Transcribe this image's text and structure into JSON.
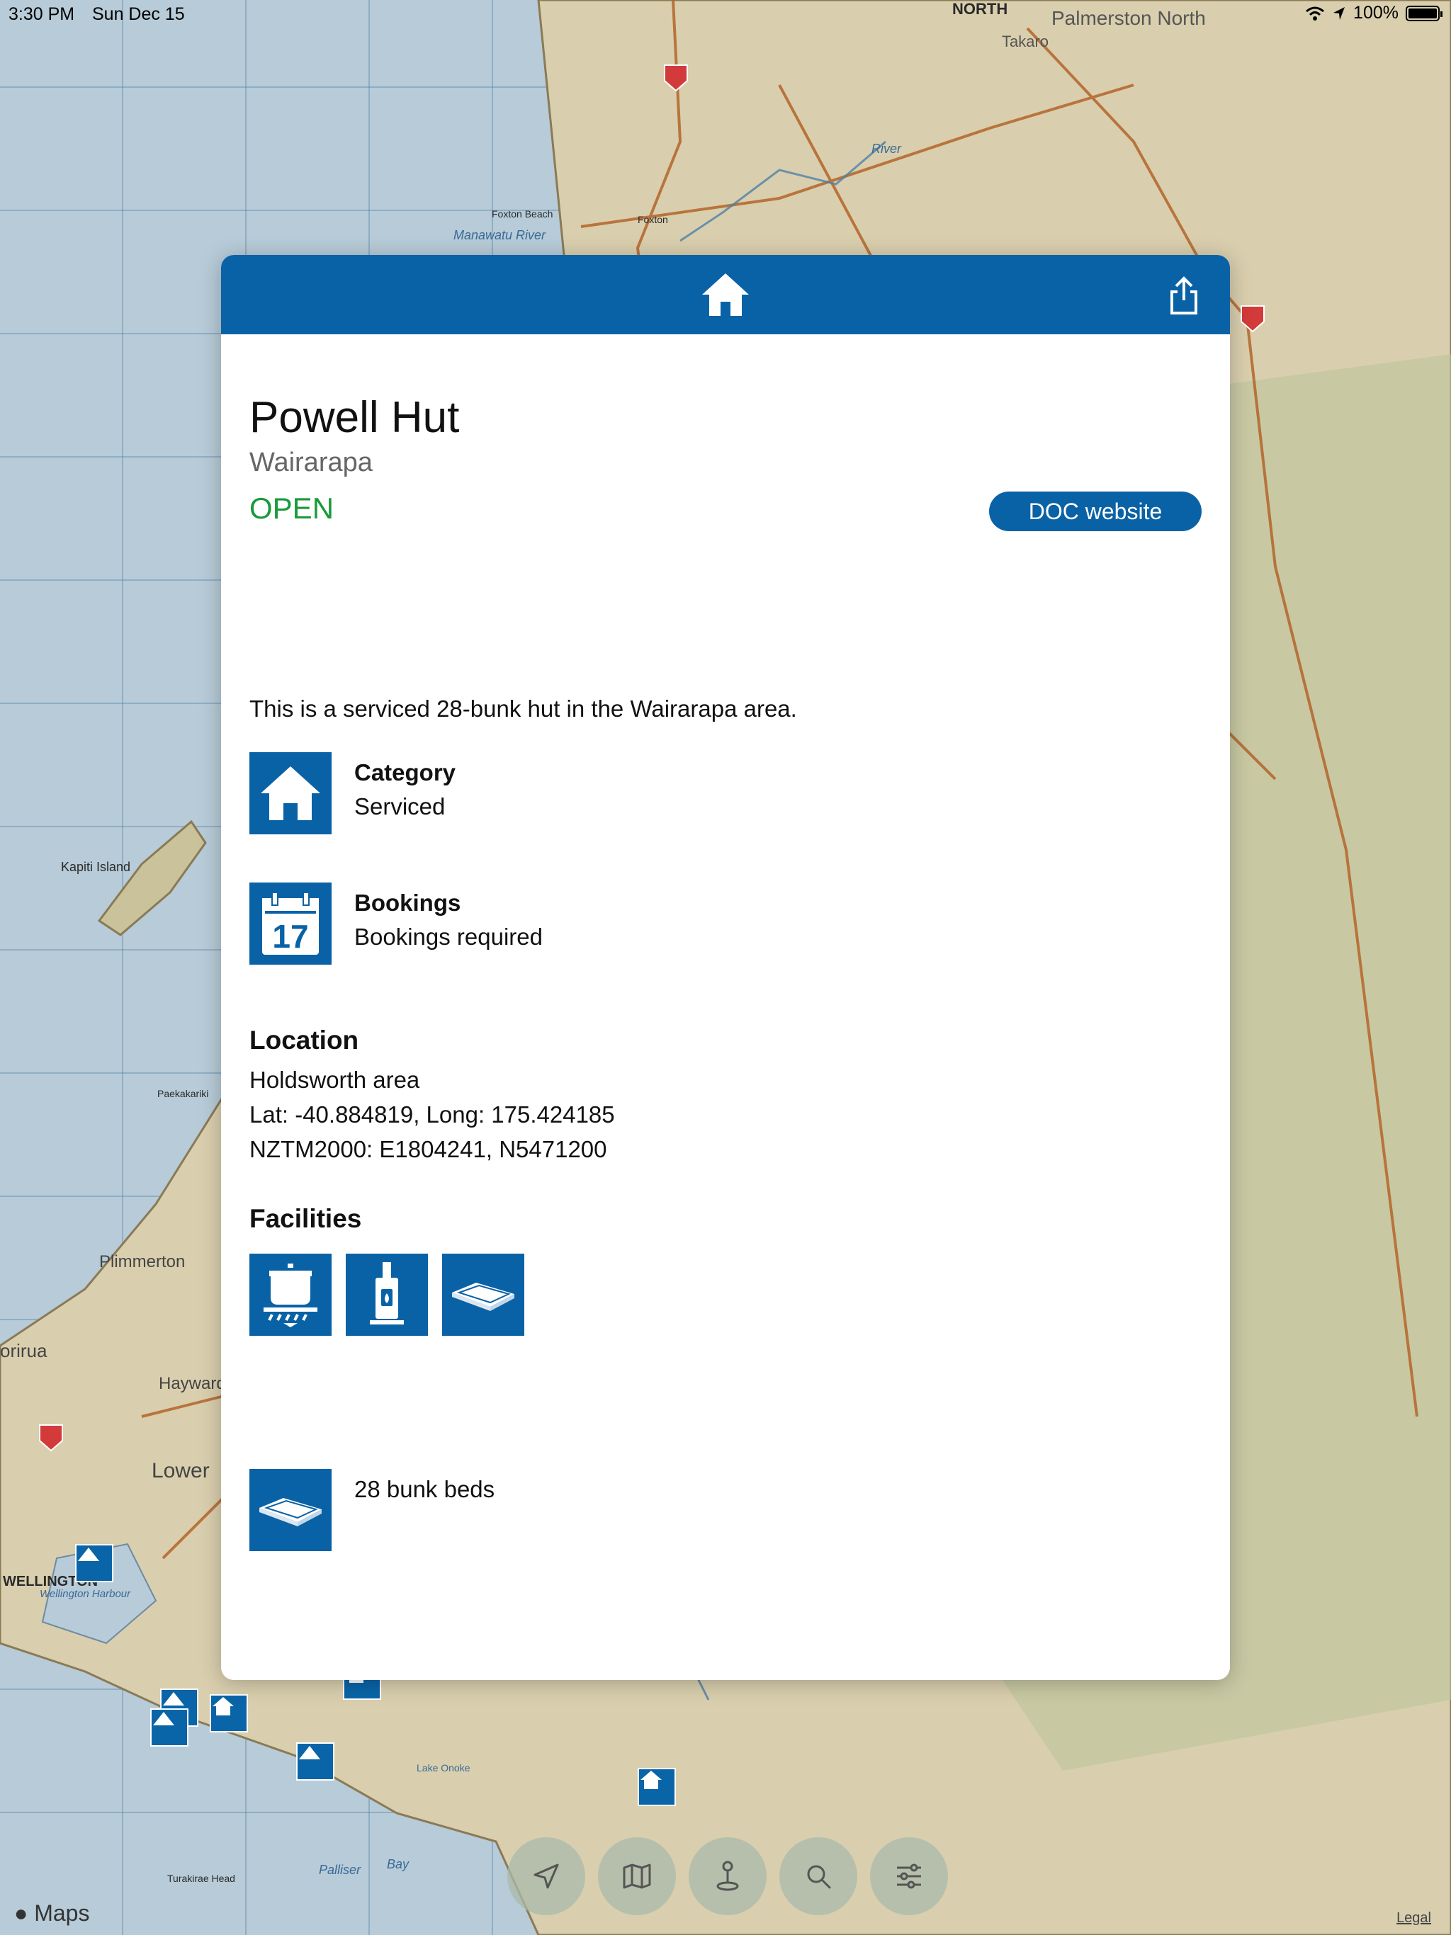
{
  "status_bar": {
    "time": "3:30 PM",
    "date": "Sun Dec 15",
    "battery": "100%"
  },
  "map": {
    "labels": {
      "palmerston_north": "Palmerston North",
      "north": "NORTH",
      "takaro": "Takaro",
      "kapiti_island": "Kapiti Island",
      "plimmerton": "Plimmerton",
      "porirua": "orirua",
      "hayward": "Hayward",
      "lower_hutt": "Lower",
      "wellington": "WELLINGTON",
      "wellington_harbour": "Wellington Harbour",
      "manawatu_river": "Manawatu River",
      "river": "River",
      "paekakariki": "Paekakariki",
      "palliser_bay": "Palliser",
      "bay": "Bay",
      "turakirae_head": "Turakirae Head",
      "lake_onoke": "Lake Onoke",
      "foxton_beach": "Foxton Beach",
      "foxton": "Foxton"
    },
    "brand": "Maps",
    "legal": "Legal"
  },
  "card": {
    "header_icon": "home-icon",
    "share_icon": "share-icon",
    "title": "Powell Hut",
    "region": "Wairarapa",
    "status": "OPEN",
    "doc_button": "DOC website",
    "description": "This is a serviced 28-bunk hut in the Wairarapa area.",
    "category": {
      "title": "Category",
      "value": "Serviced",
      "icon": "home-icon"
    },
    "bookings": {
      "title": "Bookings",
      "value": "Bookings required",
      "icon": "calendar-icon",
      "calendar_day": "17"
    },
    "location": {
      "heading": "Location",
      "area": "Holdsworth area",
      "latlong": "Lat: -40.884819, Long: 175.424185",
      "nztm": "NZTM2000: E1804241, N5471200"
    },
    "facilities": {
      "heading": "Facilities",
      "icons": [
        "cooking-icon",
        "heater-icon",
        "mattress-icon"
      ]
    },
    "bunks": {
      "icon": "mattress-icon",
      "text": "28 bunk beds"
    }
  },
  "toolbar": {
    "buttons": [
      "location-arrow-icon",
      "map-icon",
      "pin-icon",
      "search-icon",
      "sliders-icon"
    ]
  },
  "colors": {
    "brand_blue": "#0a62a6",
    "open_green": "#1a9a3a"
  }
}
